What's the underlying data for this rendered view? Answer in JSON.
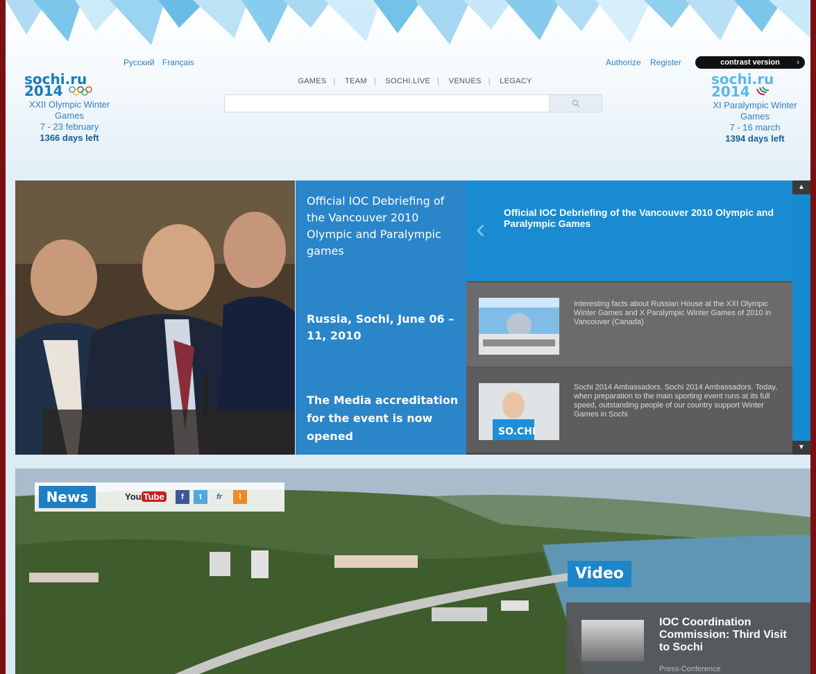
{
  "header": {
    "languages": [
      "Русский",
      "Français"
    ],
    "nav": [
      "GAMES",
      "TEAM",
      "SOCHI.LIVE",
      "VENUES",
      "LEGACY"
    ],
    "auth": {
      "authorize": "Authorize",
      "register": "Register"
    },
    "contrast_label": "contrast version",
    "contrast_chevron": "›",
    "search": {
      "placeholder": "",
      "button_icon": "search-icon"
    }
  },
  "olympic": {
    "logo_line1": "sochi.ru",
    "logo_line2": "2014",
    "name": "XXII Olympic Winter Games",
    "dates": "7 - 23 february",
    "days_left": "1366 days left"
  },
  "paralympic": {
    "logo_line1": "sochi.ru",
    "logo_line2": "2014",
    "name": "XI Paralympic Winter Games",
    "dates": "7 - 16 march",
    "days_left": "1394 days left"
  },
  "hero": {
    "text1": "Official IOC Debriefing of the Vancouver 2010 Olympic and Paralympic games",
    "text2": "Russia, Sochi, June 06 – 11, 2010",
    "text3": "The Media accreditation for the event is now opened"
  },
  "slider": {
    "active_title": "Official IOC Debriefing of the Vancouver 2010 Olympic and Paralympic Games",
    "items": [
      {
        "text": "Interesting facts about Russian House at the XXI Olympic Winter Games and X Paralympic Winter Games of 2010 in Vancouver (Canada)"
      },
      {
        "text": "Sochi 2014 Ambassadors. Sochi 2014 Ambassadors. Today, when preparation to the main sporting event runs at its full speed, outstanding people of our country support Winter Games in Sochi",
        "thumb_caption": "SO.CHI"
      }
    ]
  },
  "news": {
    "label": "News",
    "social": {
      "youtube_a": "You",
      "youtube_b": "Tube",
      "facebook": "f",
      "twitter": "t",
      "fr": "fr",
      "rss": "⌇"
    }
  },
  "video": {
    "label": "Video",
    "title": "IOC Coordination Commission: Third Visit to Sochi",
    "subtitle": "Press-Conference"
  },
  "colors": {
    "page_border": "#7a0f12",
    "accent_blue": "#1e86c8"
  }
}
